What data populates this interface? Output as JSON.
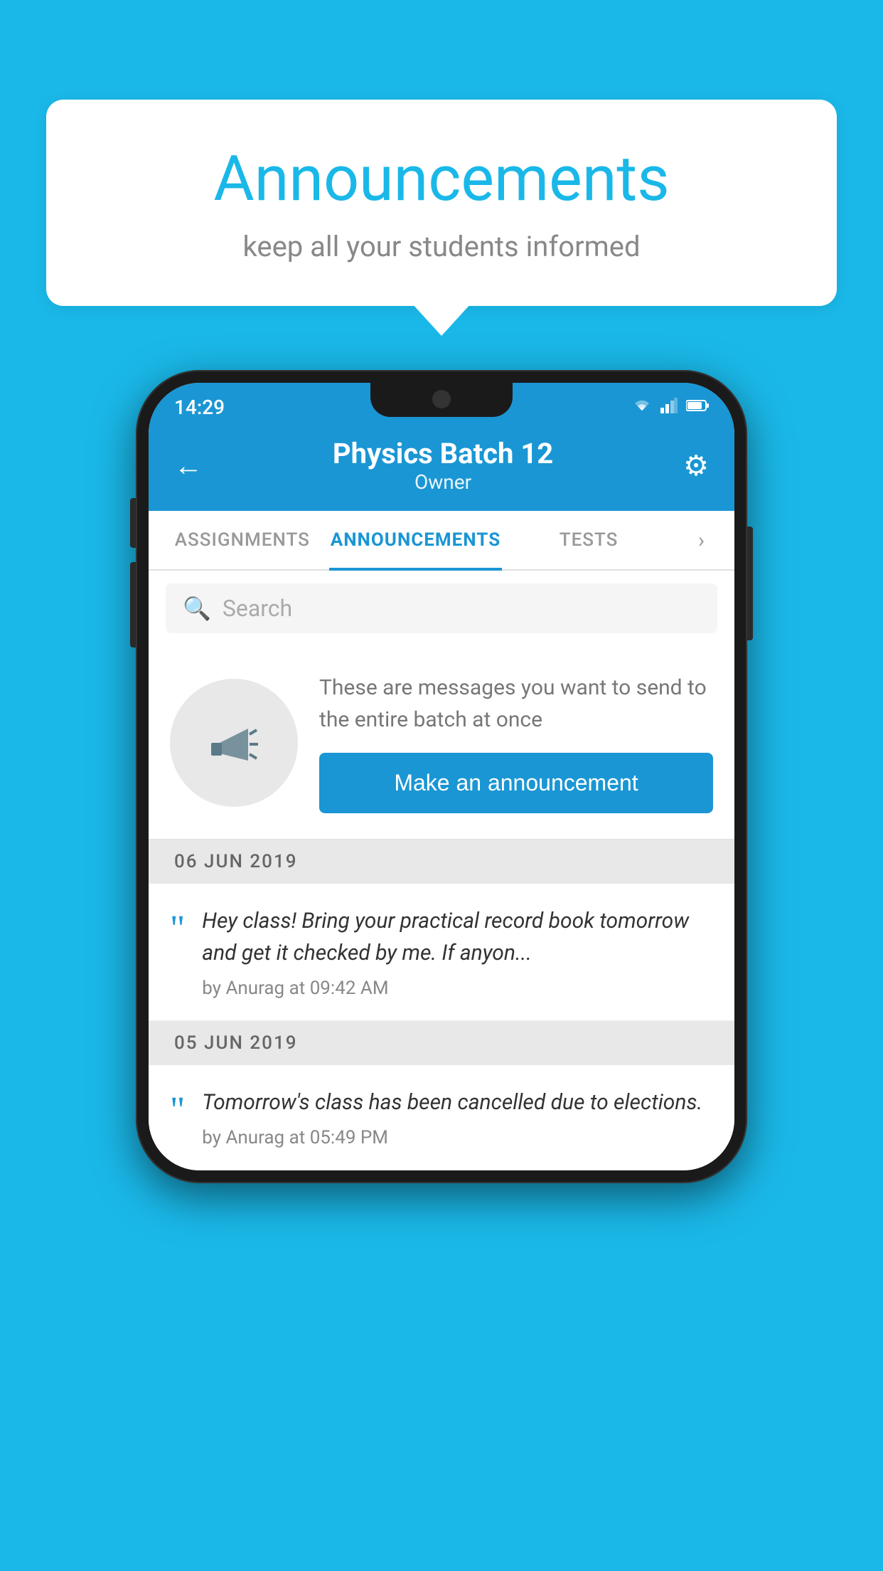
{
  "page": {
    "background_color": "#1ab8e8"
  },
  "speech_bubble": {
    "title": "Announcements",
    "subtitle": "keep all your students informed"
  },
  "status_bar": {
    "time": "14:29",
    "wifi_icon": "▾",
    "signal_icon": "▲",
    "battery_icon": "▪"
  },
  "app_header": {
    "back_icon": "←",
    "title": "Physics Batch 12",
    "subtitle": "Owner",
    "gear_icon": "⚙"
  },
  "tabs": [
    {
      "label": "ASSIGNMENTS",
      "active": false
    },
    {
      "label": "ANNOUNCEMENTS",
      "active": true
    },
    {
      "label": "TESTS",
      "active": false
    }
  ],
  "search": {
    "placeholder": "Search",
    "icon": "🔍"
  },
  "announcement_promo": {
    "icon": "📣",
    "description": "These are messages you want to send to the entire batch at once",
    "button_label": "Make an announcement"
  },
  "date_groups": [
    {
      "date": "06  JUN  2019",
      "items": [
        {
          "text": "Hey class! Bring your practical record book tomorrow and get it checked by me. If anyon...",
          "meta": "by Anurag at 09:42 AM"
        }
      ]
    },
    {
      "date": "05  JUN  2019",
      "items": [
        {
          "text": "Tomorrow's class has been cancelled due to elections.",
          "meta": "by Anurag at 05:49 PM"
        }
      ]
    }
  ]
}
